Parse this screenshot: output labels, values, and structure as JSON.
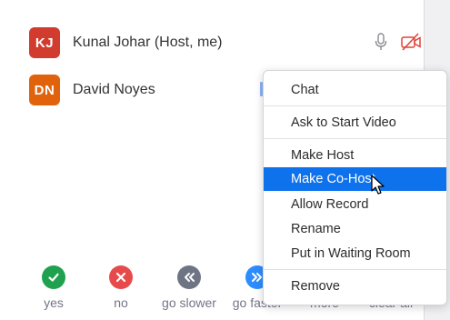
{
  "participants": [
    {
      "initials": "KJ",
      "name": "Kunal Johar (Host, me)",
      "color": "#d13c2e"
    },
    {
      "initials": "DN",
      "name": "David Noyes",
      "color": "#e0620d"
    }
  ],
  "participant_icons": [
    "microphone-icon",
    "video-off-icon"
  ],
  "reactions": [
    {
      "label": "yes",
      "color": "#1fa14f",
      "icon": "check-icon"
    },
    {
      "label": "no",
      "color": "#e64a4a",
      "icon": "x-icon"
    },
    {
      "label": "go slower",
      "color": "#6e7484",
      "icon": "rewind-icon"
    },
    {
      "label": "go faster",
      "color": "#2d8cff",
      "icon": "fast-forward-icon"
    },
    {
      "label": "more",
      "color": "#6e7484",
      "icon": "more-icon"
    },
    {
      "label": "clear all",
      "color": "#6e7484",
      "icon": "clear-icon"
    }
  ],
  "context_menu": {
    "items": [
      "Chat",
      "Ask to Start Video",
      "Make Host",
      "Make Co-Host",
      "Allow Record",
      "Rename",
      "Put in Waiting Room",
      "Remove"
    ],
    "selected": "Make Co-Host",
    "selected_color": "#0e72ed"
  }
}
